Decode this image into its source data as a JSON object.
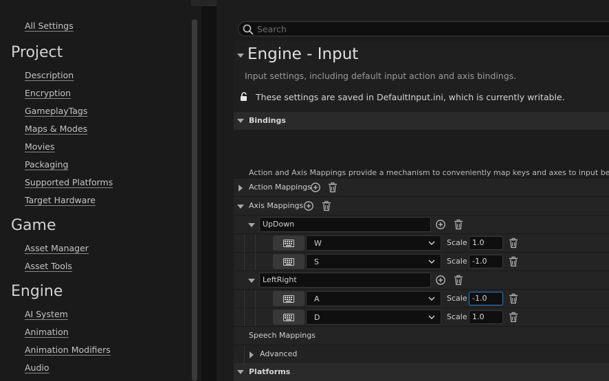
{
  "sidebar": {
    "all_settings": "All Settings",
    "sections": [
      {
        "title": "Project",
        "items": [
          "Description",
          "Encryption",
          "GameplayTags",
          "Maps & Modes",
          "Movies",
          "Packaging",
          "Supported Platforms",
          "Target Hardware"
        ]
      },
      {
        "title": "Game",
        "items": [
          "Asset Manager",
          "Asset Tools"
        ]
      },
      {
        "title": "Engine",
        "items": [
          "AI System",
          "Animation",
          "Animation Modifiers",
          "Audio"
        ]
      }
    ]
  },
  "search": {
    "placeholder": "Search"
  },
  "page": {
    "title": "Engine - Input",
    "subtitle": "Input settings, including default input action and axis bindings.",
    "writable_note": "These settings are saved in DefaultInput.ini, which is currently writable."
  },
  "bindings": {
    "label": "Bindings",
    "description": "Action and Axis Mappings provide a mechanism to conveniently map keys and axes to input behaviors b",
    "action_mappings_label": "Action Mappings",
    "axis_mappings_label": "Axis Mappings",
    "axis_mappings": [
      {
        "name": "UpDown",
        "keys": [
          {
            "key": "W",
            "scale_label": "Scale",
            "scale": "1.0"
          },
          {
            "key": "S",
            "scale_label": "Scale",
            "scale": "-1.0"
          }
        ]
      },
      {
        "name": "LeftRight",
        "keys": [
          {
            "key": "A",
            "scale_label": "Scale",
            "scale": "-1.0"
          },
          {
            "key": "D",
            "scale_label": "Scale",
            "scale": "1.0"
          }
        ]
      }
    ],
    "speech_mappings_label": "Speech Mappings",
    "advanced_label": "Advanced"
  },
  "platforms": {
    "label": "Platforms"
  },
  "colors": {
    "focus_accent": "#2b7fd9",
    "panel_bg": "#1c1c1c",
    "sidebar_bg": "#1a1a1a"
  }
}
